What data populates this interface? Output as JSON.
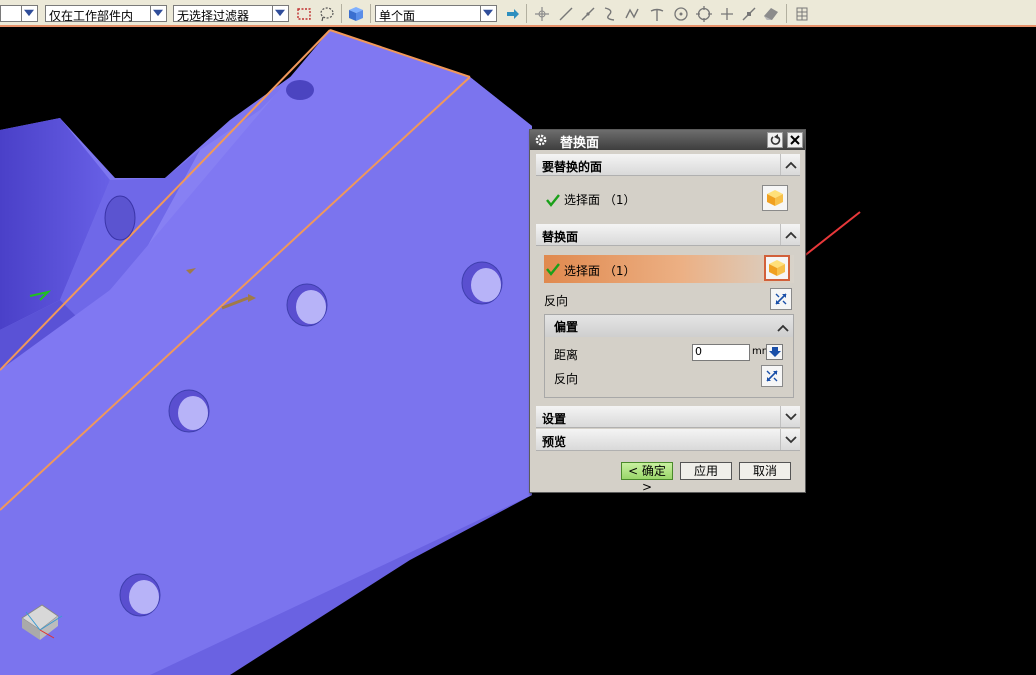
{
  "toolbar": {
    "dropdown_filter_type": "",
    "dropdown_scope": "仅在工作部件内",
    "dropdown_filter": "无选择过滤器",
    "dropdown_face_rule": "单个面",
    "icons": [
      "select-rectangle-icon",
      "lasso-icon",
      "cube-icon",
      "arrow-right-icon",
      "snap-point-icon",
      "line-icon",
      "tangent-icon",
      "curve-icon",
      "polyline-icon",
      "intersection-icon",
      "circle-center-icon",
      "quadrant-icon",
      "plus-icon",
      "midpoint-icon",
      "eraser-icon",
      "grid-icon"
    ]
  },
  "dialog": {
    "title": "替换面",
    "section_replace_target": {
      "label": "要替换的面",
      "select_label": "选择面 （1）"
    },
    "section_replacement": {
      "label": "替换面",
      "select_label": "选择面 （1）",
      "reverse_label": "反向",
      "offset": {
        "label": "偏置",
        "distance_label": "距离",
        "distance_value": "0",
        "unit": "mm",
        "reverse_label": "反向"
      }
    },
    "section_settings": {
      "label": "设置"
    },
    "section_preview": {
      "label": "预览"
    },
    "buttons": {
      "ok": "< 确定 >",
      "apply": "应用",
      "cancel": "取消"
    }
  },
  "viewport": {
    "part_color": "#7b74ee",
    "edge_highlight": "#f0985a",
    "background": "#000000",
    "annotation_arrow_color": "#e8383a"
  }
}
